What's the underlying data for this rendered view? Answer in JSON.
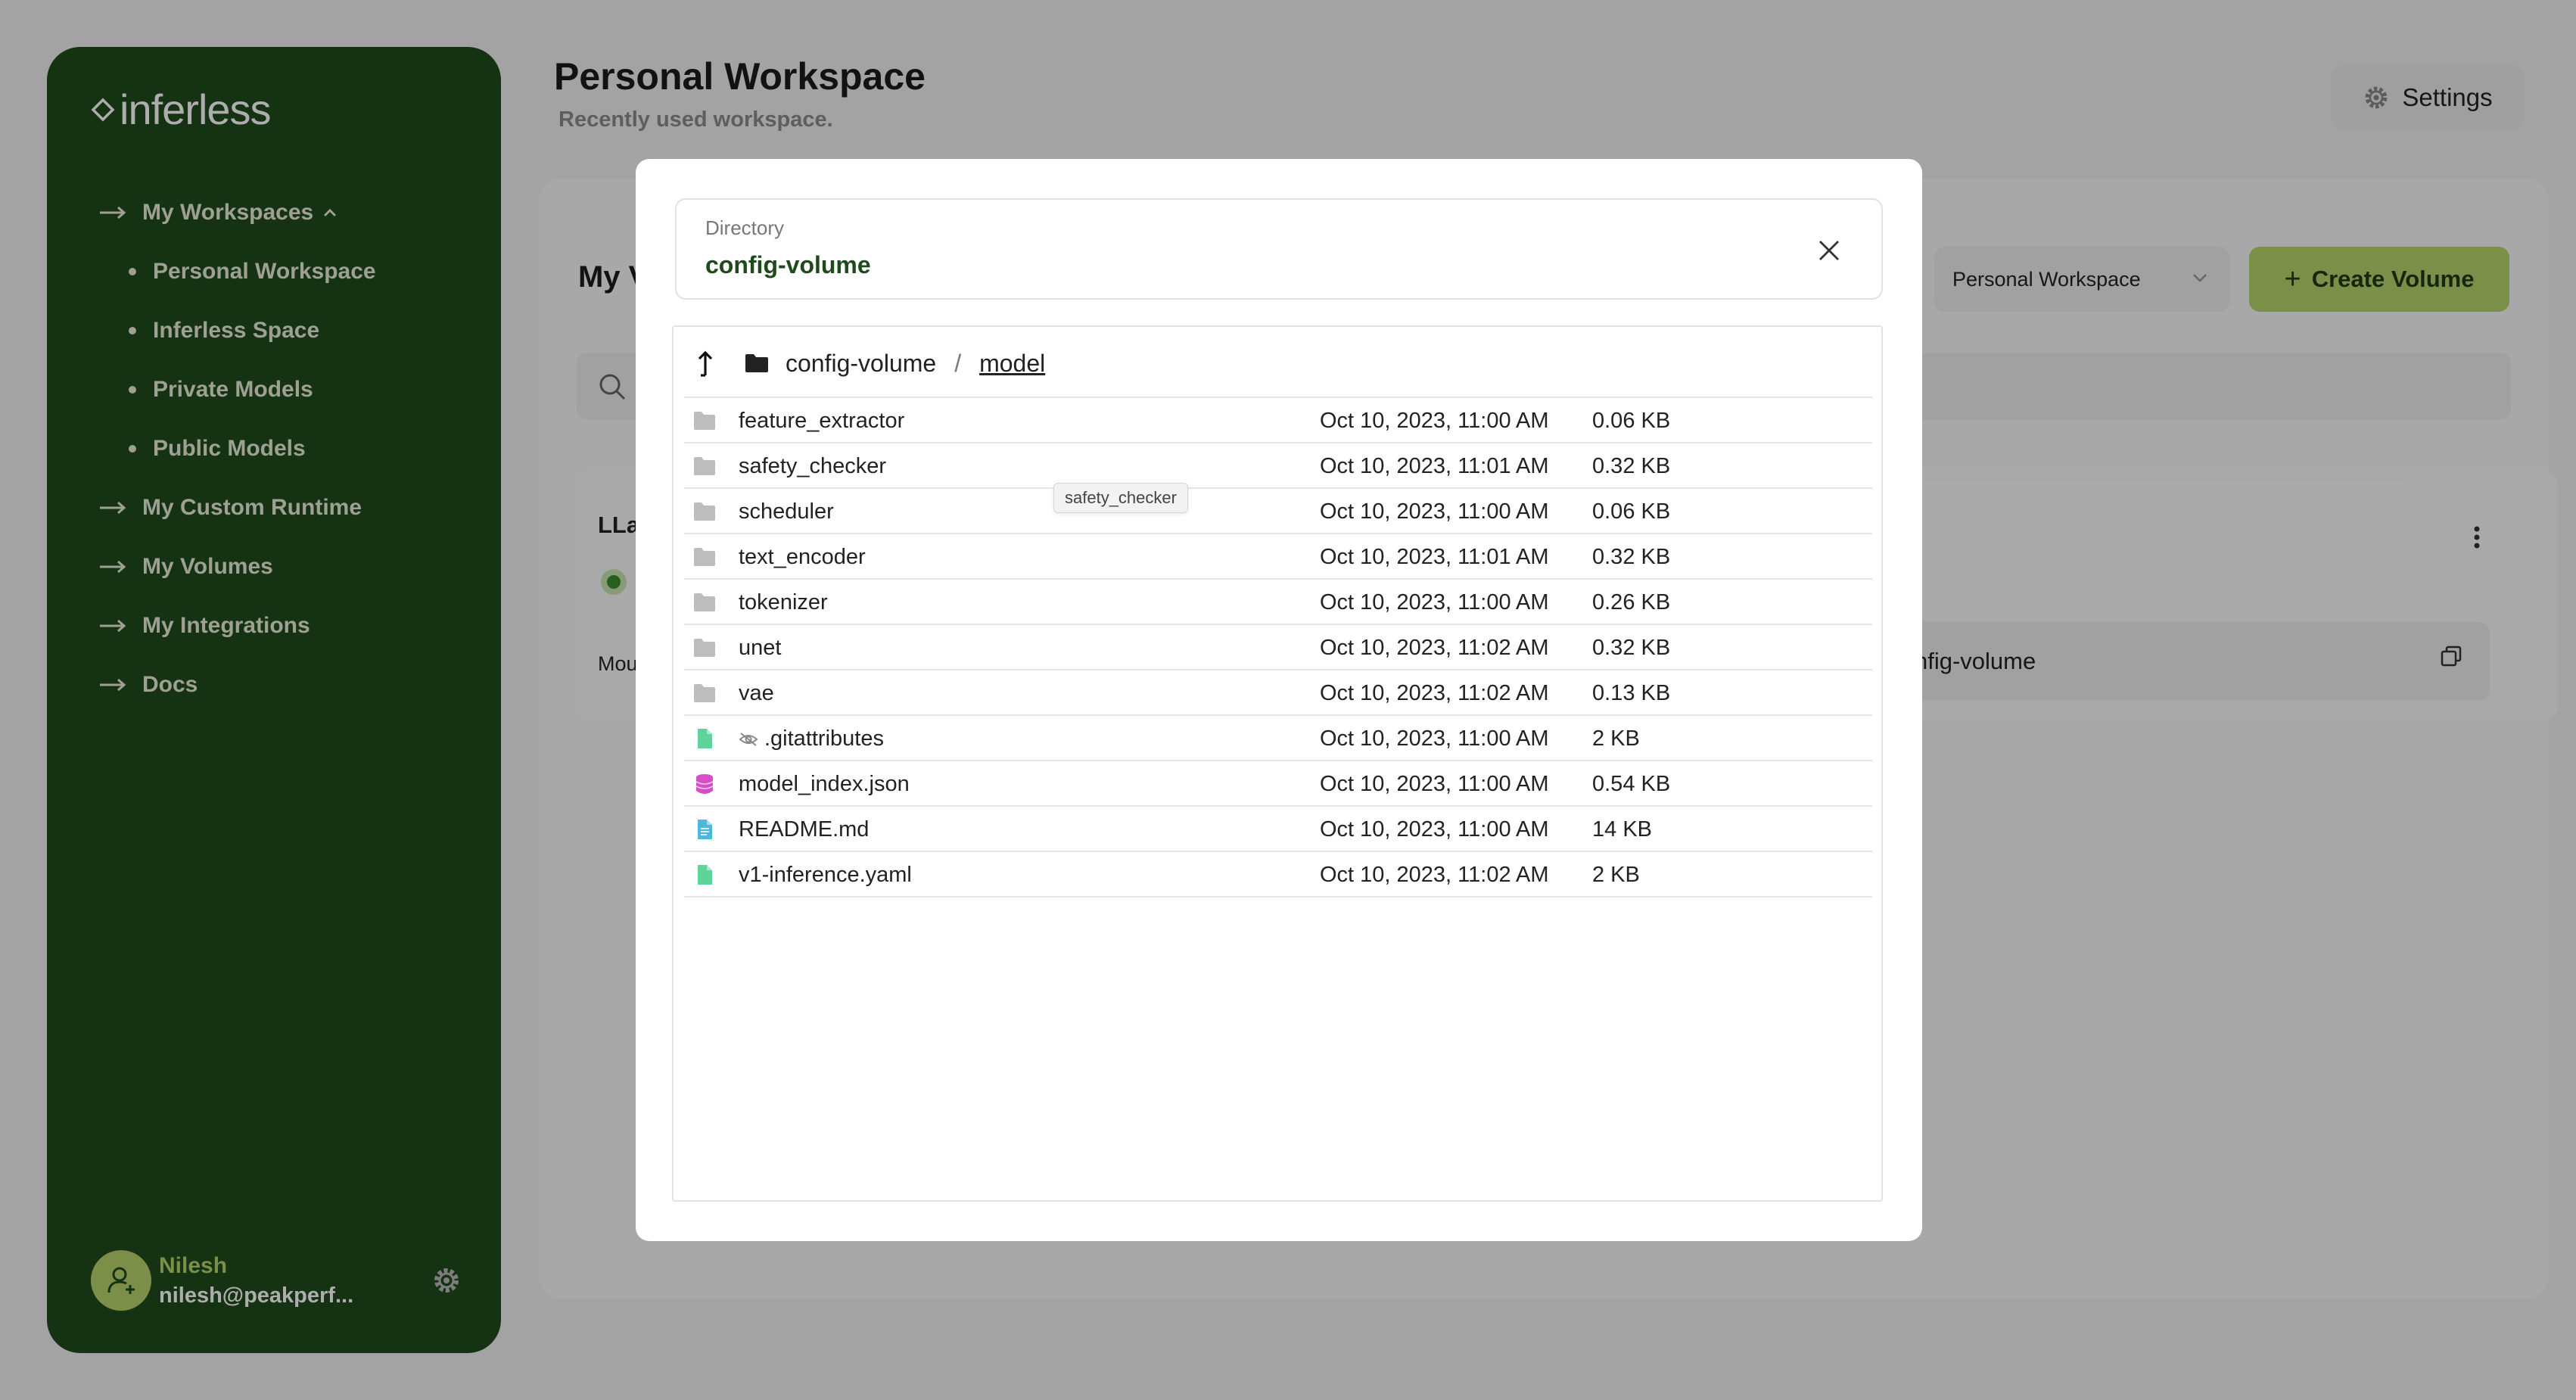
{
  "app": {
    "logo_text": "inferless"
  },
  "sidebar": {
    "workspaces_label": "My Workspaces",
    "workspace_items": [
      {
        "label": "Personal Workspace"
      },
      {
        "label": "Inferless Space"
      },
      {
        "label": "Private Models"
      },
      {
        "label": "Public Models"
      }
    ],
    "nav_items": [
      {
        "label": "My Custom Runtime"
      },
      {
        "label": "My Volumes"
      },
      {
        "label": "My Integrations"
      },
      {
        "label": "Docs"
      }
    ],
    "user": {
      "name": "Nilesh",
      "email": "nilesh@peakperf..."
    }
  },
  "header": {
    "title": "Personal Workspace",
    "subtitle": "Recently used workspace.",
    "settings_label": "Settings"
  },
  "volumes_page": {
    "heading": "My V",
    "workspace_select": "Personal Workspace",
    "create_label": "Create Volume",
    "volume_card": {
      "name": "LLa",
      "mount_label": "Mou",
      "mount_value": "nfig-volume"
    }
  },
  "modal": {
    "directory_label": "Directory",
    "directory_value": "config-volume",
    "breadcrumb": {
      "root": "config-volume",
      "separator": "/",
      "current": "model"
    },
    "tooltip": "safety_checker",
    "files": [
      {
        "name": "feature_extractor",
        "type": "folder",
        "date": "Oct 10, 2023, 11:00 AM",
        "size": "0.06 KB"
      },
      {
        "name": "safety_checker",
        "type": "folder",
        "date": "Oct 10, 2023, 11:01 AM",
        "size": "0.32 KB"
      },
      {
        "name": "scheduler",
        "type": "folder",
        "date": "Oct 10, 2023, 11:00 AM",
        "size": "0.06 KB"
      },
      {
        "name": "text_encoder",
        "type": "folder",
        "date": "Oct 10, 2023, 11:01 AM",
        "size": "0.32 KB"
      },
      {
        "name": "tokenizer",
        "type": "folder",
        "date": "Oct 10, 2023, 11:00 AM",
        "size": "0.26 KB"
      },
      {
        "name": "unet",
        "type": "folder",
        "date": "Oct 10, 2023, 11:02 AM",
        "size": "0.32 KB"
      },
      {
        "name": "vae",
        "type": "folder",
        "date": "Oct 10, 2023, 11:02 AM",
        "size": "0.13 KB"
      },
      {
        "name": ".gitattributes",
        "type": "hidden-file",
        "date": "Oct 10, 2023, 11:00 AM",
        "size": "2 KB"
      },
      {
        "name": "model_index.json",
        "type": "database",
        "date": "Oct 10, 2023, 11:00 AM",
        "size": "0.54 KB"
      },
      {
        "name": "README.md",
        "type": "document",
        "date": "Oct 10, 2023, 11:00 AM",
        "size": "14 KB"
      },
      {
        "name": "v1-inference.yaml",
        "type": "file",
        "date": "Oct 10, 2023, 11:02 AM",
        "size": "2 KB"
      }
    ]
  },
  "colors": {
    "sidebar_bg": "#1f4a1c",
    "accent": "#b7d36b",
    "folder_icon": "#bdbdbd",
    "file_icon": "#5ed39a",
    "database_icon": "#d54fc4",
    "document_icon": "#4fb7d9"
  }
}
